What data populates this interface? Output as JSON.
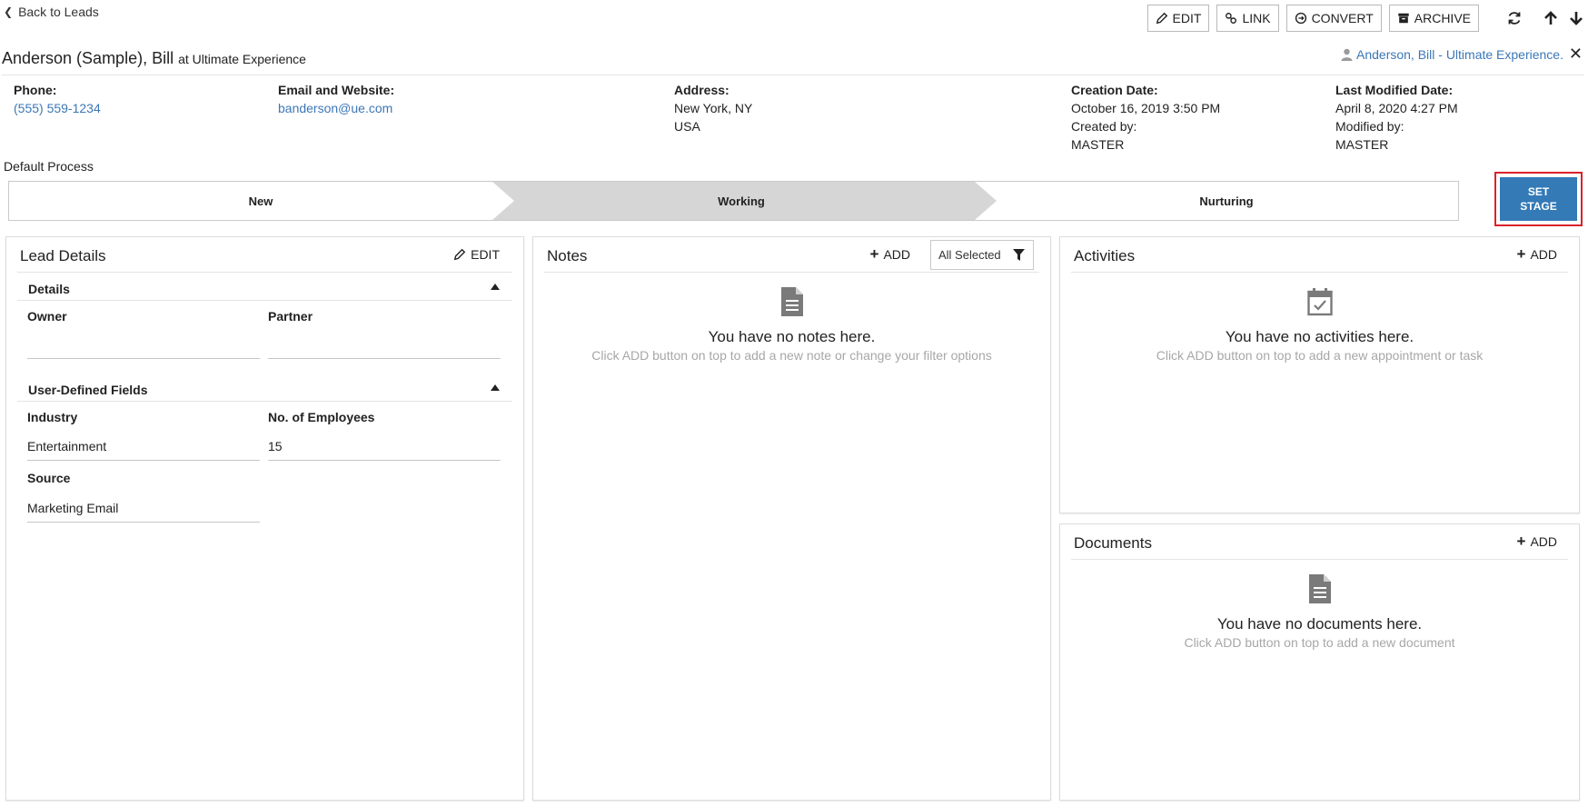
{
  "nav": {
    "back_label": "Back to Leads"
  },
  "toolbar": {
    "edit": "EDIT",
    "link": "LINK",
    "convert": "CONVERT",
    "archive": "ARCHIVE",
    "icons": [
      "refresh-icon",
      "arrow-up-icon",
      "arrow-down-icon"
    ]
  },
  "header": {
    "name": "Anderson (Sample), Bill",
    "at_label": "at Ultimate Experience",
    "contact_link": "Anderson, Bill - Ultimate Experience."
  },
  "info": {
    "phone_label": "Phone:",
    "phone_value": "(555) 559-1234",
    "email_label": "Email and Website:",
    "email_value": "banderson@ue.com",
    "address_label": "Address:",
    "address_line1": "New York, NY",
    "address_line2": "USA",
    "creation_label": "Creation Date:",
    "creation_value": "October 16, 2019 3:50 PM",
    "created_by_label": "Created by:",
    "created_by_value": "MASTER",
    "modified_label": "Last Modified Date:",
    "modified_value": "April 8, 2020 4:27 PM",
    "modified_by_label": "Modified by:",
    "modified_by_value": "MASTER"
  },
  "process": {
    "label": "Default Process",
    "stages": [
      "New",
      "Working",
      "Nurturing"
    ],
    "active_stage": "Working",
    "set_stage_line1": "SET",
    "set_stage_line2": "STAGE",
    "colors": {
      "active": "#d6d6d6",
      "accent": "#337ab7",
      "highlight": "#d9222a"
    }
  },
  "lead_details": {
    "title": "Lead Details",
    "edit_label": "EDIT",
    "details_section": "Details",
    "owner_label": "Owner",
    "partner_label": "Partner",
    "udf_section": "User-Defined Fields",
    "industry_label": "Industry",
    "industry_value": "Entertainment",
    "employees_label": "No. of Employees",
    "employees_value": "15",
    "source_label": "Source",
    "source_value": "Marketing Email"
  },
  "notes": {
    "title": "Notes",
    "add_label": "ADD",
    "filter_value": "All Selected",
    "empty_title": "You have no notes here.",
    "empty_sub": "Click ADD button on top to add a new note or change your filter options"
  },
  "activities": {
    "title": "Activities",
    "add_label": "ADD",
    "empty_title": "You have no activities here.",
    "empty_sub": "Click ADD button on top to add a new appointment or task"
  },
  "documents": {
    "title": "Documents",
    "add_label": "ADD",
    "empty_title": "You have no documents here.",
    "empty_sub": "Click ADD button on top to add a new document"
  }
}
